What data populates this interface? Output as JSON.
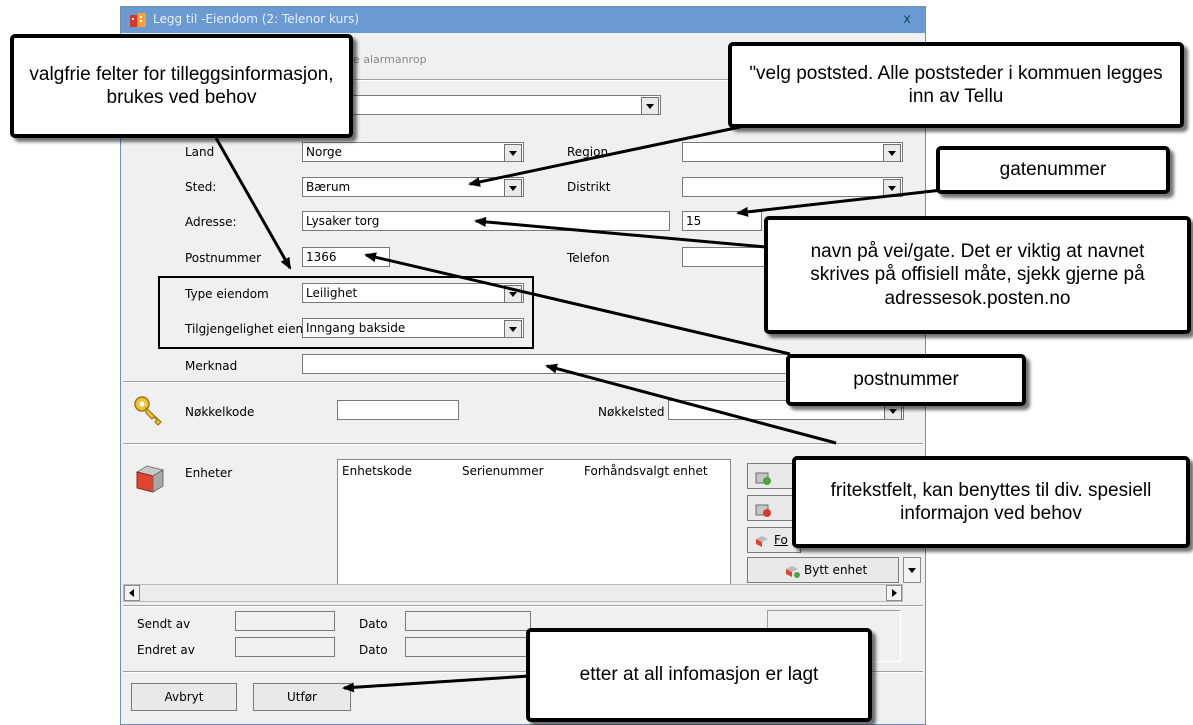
{
  "window": {
    "title": "Legg til -Eiendom (2: Telenor kurs)",
    "close_glyph": "x",
    "tab_fragment": "e alarmanrop"
  },
  "form": {
    "land_label": "Land",
    "land_value": "Norge",
    "region_label": "Region",
    "region_value": "",
    "sted_label": "Sted:",
    "sted_value": "Bærum",
    "distrikt_label": "Distrikt",
    "distrikt_value": "",
    "adresse_label": "Adresse:",
    "adresse_value": "Lysaker torg",
    "gatenummer_value": "15",
    "postnummer_label": "Postnummer",
    "postnummer_value": "1366",
    "telefon_label": "Telefon",
    "telefon_value": "",
    "type_label": "Type eiendom",
    "type_value": "Leilighet",
    "tilgjengelighet_label": "Tilgjengelighet eiendo",
    "tilgjengelighet_value": "Inngang bakside",
    "merknad_label": "Merknad",
    "merknad_value": ""
  },
  "keys": {
    "kode_label": "Nøkkelkode",
    "kode_value": "",
    "sted_label": "Nøkkelsted",
    "sted_value": ""
  },
  "units": {
    "label": "Enheter",
    "columns": [
      "Enhetskode",
      "Serienummer",
      "Forhåndsvalgt enhet"
    ],
    "fo_button_fragment": "Fo",
    "bytt_button": "Bytt enhet"
  },
  "footer": {
    "sendt_label": "Sendt av",
    "sendt_value": "",
    "endret_label": "Endret av",
    "endret_value": "",
    "dato1_label": "Dato",
    "dato1_value": "",
    "dato2_label": "Dato",
    "dato2_value": "",
    "cancel_button": "Avbryt",
    "execute_button": "Utfør"
  },
  "callouts": {
    "optional": "valgfrie felter for tilleggsinformasjon, brukes ved behov",
    "poststed": "ʺvelg poststed. Alle poststeder i kommuen legges inn av Tellu",
    "gatenummer": "gatenummer",
    "gate": "navn på vei/gate. Det er viktig at navnet skrives på offisiell måte, sjekk gjerne på adressesok.posten.no",
    "postnummer": "postnummer",
    "fritekst": "fritekstfelt, kan benyttes til div. spesiell informajon ved behov",
    "etter": "etter at all infomasjon er lagt"
  }
}
